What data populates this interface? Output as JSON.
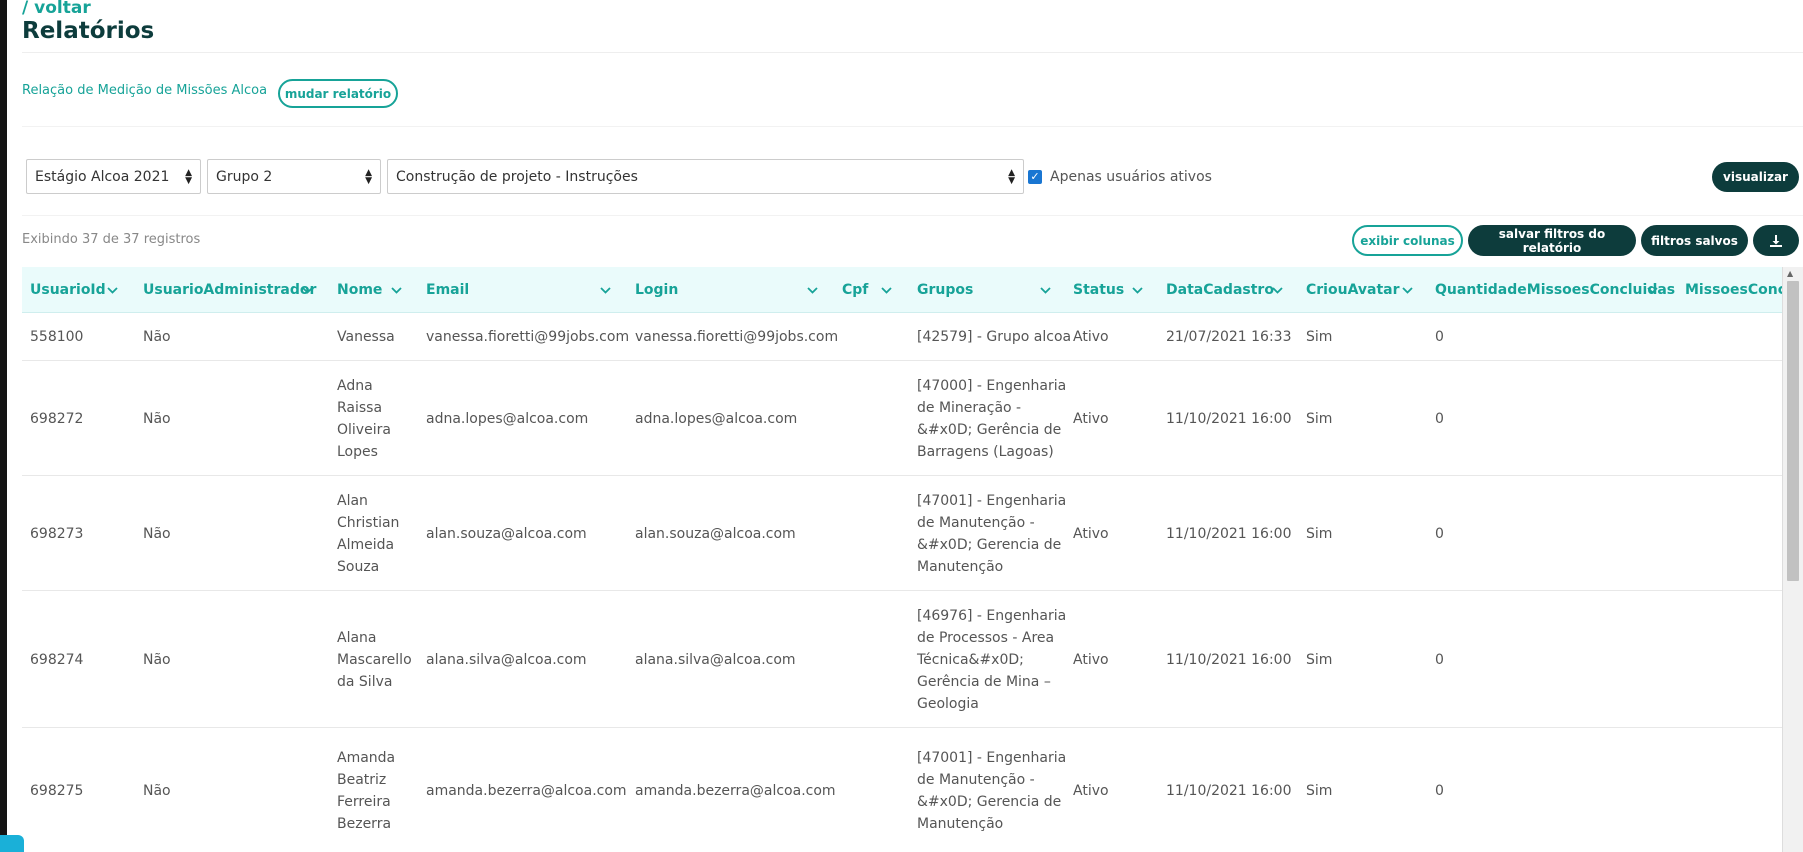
{
  "header": {
    "back_label": "/ voltar",
    "title": "Relatórios"
  },
  "report": {
    "name": "Relação de Medição de Missões Alcoa",
    "change_button": "mudar relatório"
  },
  "filters": {
    "program": "Estágio Alcoa 2021",
    "group": "Grupo 2",
    "mission": "Construção de projeto - Instruções",
    "active_only_label": "Apenas usuários ativos",
    "active_only_checked": true,
    "visualize_button": "visualizar"
  },
  "toolbar": {
    "records_text": "Exibindo 37 de 37 registros",
    "show_columns": "exibir colunas",
    "save_filters": "salvar filtros do relatório",
    "saved_filters": "filtros salvos",
    "download_icon": "download-icon"
  },
  "table": {
    "columns": [
      "UsuarioId",
      "UsuarioAdministrador",
      "Nome",
      "Email",
      "Login",
      "Cpf",
      "Grupos",
      "Status",
      "DataCadastro",
      "CriouAvatar",
      "QuantidadeMissoesConcluidas",
      "MissoesConclu"
    ],
    "rows": [
      {
        "id": "558100",
        "admin": "Não",
        "nome": [
          "Vanessa"
        ],
        "email": "vanessa.fioretti@99jobs.com",
        "login": "vanessa.fioretti@99jobs.com",
        "cpf": "",
        "grupos": [
          "[42579] - Grupo alcoa"
        ],
        "status": "Ativo",
        "data": "21/07/2021 16:33",
        "avatar": "Sim",
        "qtd": "0"
      },
      {
        "id": "698272",
        "admin": "Não",
        "nome": [
          "Adna",
          "Raissa",
          "Oliveira",
          "Lopes"
        ],
        "email": "adna.lopes@alcoa.com",
        "login": "adna.lopes@alcoa.com",
        "cpf": "",
        "grupos": [
          "[47000] - Engenharia",
          "de Mineração -",
          "&#x0D; Gerência de",
          "Barragens (Lagoas)"
        ],
        "status": "Ativo",
        "data": "11/10/2021 16:00",
        "avatar": "Sim",
        "qtd": "0"
      },
      {
        "id": "698273",
        "admin": "Não",
        "nome": [
          "Alan",
          "Christian",
          "Almeida",
          "Souza"
        ],
        "email": "alan.souza@alcoa.com",
        "login": "alan.souza@alcoa.com",
        "cpf": "",
        "grupos": [
          "[47001] - Engenharia",
          "de Manutenção -",
          "&#x0D; Gerencia de",
          "Manutenção"
        ],
        "status": "Ativo",
        "data": "11/10/2021 16:00",
        "avatar": "Sim",
        "qtd": "0"
      },
      {
        "id": "698274",
        "admin": "Não",
        "nome": [
          "Alana",
          "Mascarello",
          "da Silva"
        ],
        "email": "alana.silva@alcoa.com",
        "login": "alana.silva@alcoa.com",
        "cpf": "",
        "grupos": [
          "[46976] - Engenharia",
          "de Processos - Area",
          "Técnica&#x0D;",
          "Gerência de Mina –",
          "Geologia"
        ],
        "status": "Ativo",
        "data": "11/10/2021 16:00",
        "avatar": "Sim",
        "qtd": "0"
      },
      {
        "id": "698275",
        "admin": "Não",
        "nome": [
          "Amanda",
          "Beatriz",
          "Ferreira",
          "Bezerra"
        ],
        "email": "amanda.bezerra@alcoa.com",
        "login": "amanda.bezerra@alcoa.com",
        "cpf": "",
        "grupos": [
          "[47001] - Engenharia",
          "de Manutenção -",
          "&#x0D; Gerencia de",
          "Manutenção"
        ],
        "status": "Ativo",
        "data": "11/10/2021 16:00",
        "avatar": "Sim",
        "qtd": "0"
      }
    ]
  },
  "colors": {
    "accent": "#17a398",
    "dark": "#0d3c3c",
    "header_bg": "#eafbfb",
    "checkbox": "#1976d2"
  }
}
